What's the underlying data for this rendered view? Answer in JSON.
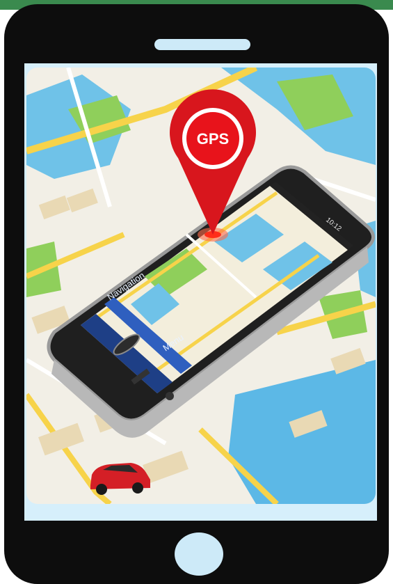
{
  "pin": {
    "label": "GPS"
  },
  "phone_ui": {
    "nav_button_label": "Navigation",
    "menu_button_label": "Menu",
    "status_time": "10:12"
  },
  "icons": [
    "phone-frame",
    "gps-pin-icon",
    "car-icon",
    "home-button",
    "speaker-slot"
  ],
  "colors": {
    "frame": "#0d0d0d",
    "accent_strip": "#3a8a4e",
    "pin": "#d8161d",
    "screen_bg": "#d6effb"
  }
}
